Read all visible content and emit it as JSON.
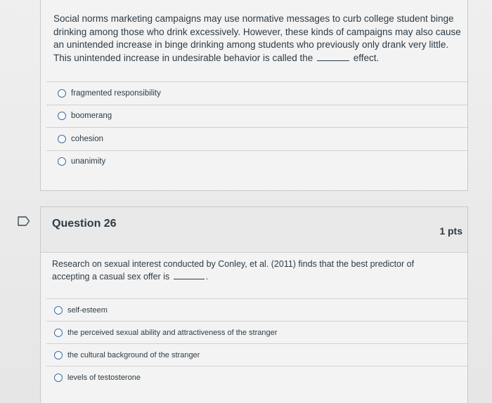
{
  "question25": {
    "text_before_blank": "Social norms marketing campaigns may use normative messages to curb college student binge drinking among those who drink excessively. However, these kinds of campaigns may also cause an unintended increase in binge drinking among students who previously only drank very little. This unintended increase in undesirable behavior is called the",
    "text_after_blank": "effect.",
    "options": [
      {
        "label": "fragmented responsibility"
      },
      {
        "label": "boomerang"
      },
      {
        "label": "cohesion"
      },
      {
        "label": "unanimity"
      }
    ]
  },
  "question26": {
    "title": "Question 26",
    "points": "1 pts",
    "text_before_blank": "Research on sexual interest conducted by Conley, et al. (2011) finds that the best predictor of accepting a casual sex offer is",
    "text_after_blank": ".",
    "options": [
      {
        "label": "self-esteem"
      },
      {
        "label": "the perceived sexual ability and attractiveness of the stranger"
      },
      {
        "label": "the cultural background of the stranger"
      },
      {
        "label": "levels of testosterone"
      }
    ]
  },
  "icons": {
    "flag": "flag-question-icon",
    "cursor": "mouse-pointer-icon"
  },
  "colors": {
    "text": "#2d3b45",
    "radio_border": "#3a6fa8",
    "card_bg": "#f3f3f3",
    "header_bg": "#e9e9e9"
  }
}
